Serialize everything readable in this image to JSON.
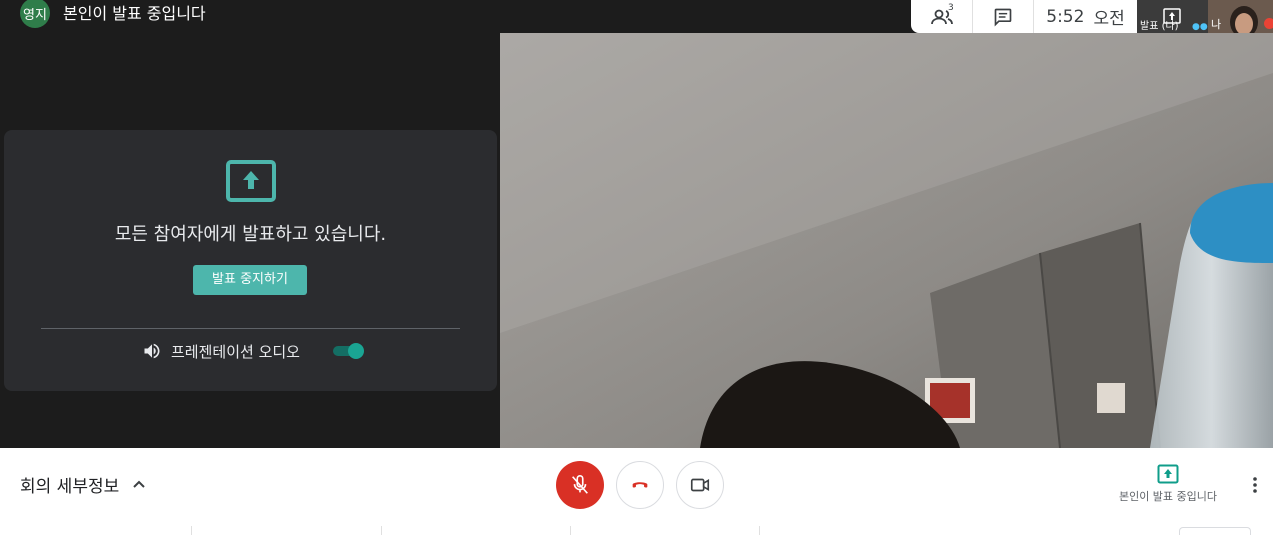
{
  "presenter": {
    "avatar_text": "영지",
    "status": "본인이 발표 중입니다"
  },
  "share_card": {
    "message": "모든 참여자에게 발표하고 있습니다.",
    "stop_button": "발표 중지하기",
    "audio_label": "프레젠테이션 오디오",
    "audio_enabled": true
  },
  "info_panel": {
    "participant_count": "3",
    "time": "5:52",
    "ampm": "오전"
  },
  "thumbnails": {
    "first_label": "발표 (나)",
    "second_label": "나",
    "first_icon": "present-to-all-icon"
  },
  "bottom_bar": {
    "meeting_details": "회의 세부정보",
    "presenting_label": "본인이 발표 중입니다"
  },
  "colors": {
    "accent": "#4db6ac",
    "mic_off": "#d93025",
    "hangup": "#d93025",
    "avatar": "#2f7d4a"
  }
}
